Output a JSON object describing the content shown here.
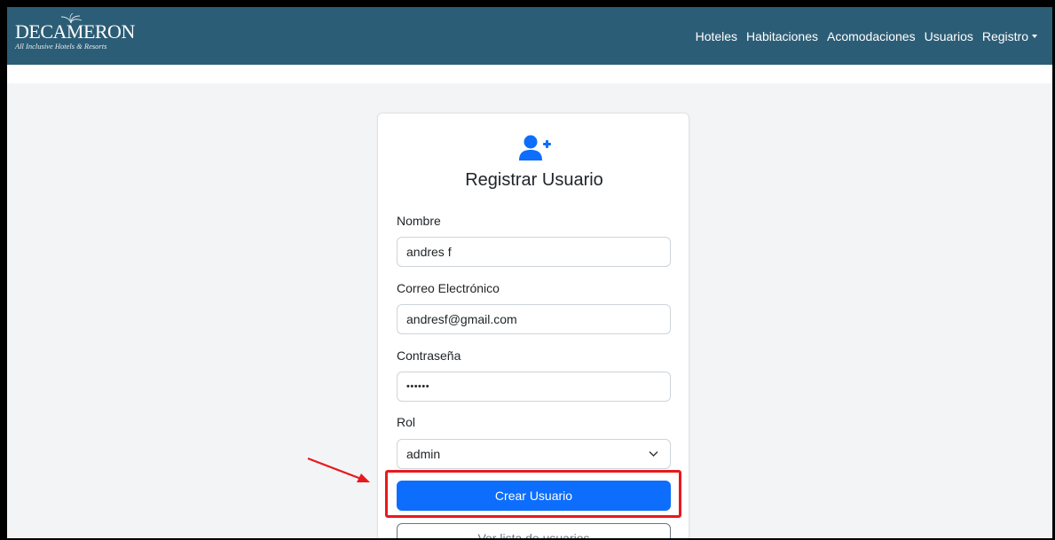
{
  "brand": {
    "name": "DECAMERON",
    "tagline": "All Inclusive Hotels & Resorts"
  },
  "nav": {
    "items": [
      {
        "label": "Hoteles"
      },
      {
        "label": "Habitaciones"
      },
      {
        "label": "Acomodaciones"
      },
      {
        "label": "Usuarios"
      },
      {
        "label": "Registro",
        "dropdown": true
      }
    ]
  },
  "form": {
    "icon": "user-plus-icon",
    "title": "Registrar Usuario",
    "fields": {
      "name": {
        "label": "Nombre",
        "value": "andres f"
      },
      "email": {
        "label": "Correo Electrónico",
        "value": "andresf@gmail.com"
      },
      "password": {
        "label": "Contraseña",
        "value": "••••••"
      },
      "role": {
        "label": "Rol",
        "value": "admin"
      }
    },
    "submit_label": "Crear Usuario",
    "list_label": "Ver lista de usuarios"
  },
  "colors": {
    "navbar": "#2c5d76",
    "primary": "#0d6efd",
    "highlight": "#e8191e"
  }
}
